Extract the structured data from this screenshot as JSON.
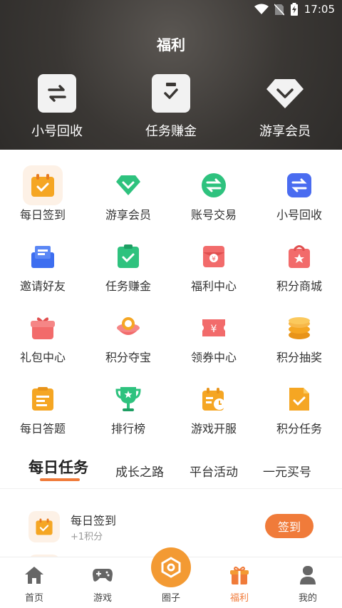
{
  "status_bar": {
    "time": "17:05"
  },
  "header": {
    "title": "福利",
    "hero": [
      {
        "label": "小号回收",
        "icon": "swap-icon"
      },
      {
        "label": "任务赚金",
        "icon": "clipboard-check-icon"
      },
      {
        "label": "游享会员",
        "icon": "diamond-icon"
      }
    ]
  },
  "grid": [
    {
      "label": "每日签到",
      "icon": "calendar-check-icon"
    },
    {
      "label": "游享会员",
      "icon": "diamond-icon"
    },
    {
      "label": "账号交易",
      "icon": "exchange-icon"
    },
    {
      "label": "小号回收",
      "icon": "swap-icon"
    },
    {
      "label": "邀请好友",
      "icon": "envelope-icon"
    },
    {
      "label": "任务赚金",
      "icon": "clipboard-check-icon"
    },
    {
      "label": "福利中心",
      "icon": "red-envelope-icon"
    },
    {
      "label": "积分商城",
      "icon": "shop-bag-icon"
    },
    {
      "label": "礼包中心",
      "icon": "gift-icon"
    },
    {
      "label": "积分夺宝",
      "icon": "treasure-icon"
    },
    {
      "label": "领券中心",
      "icon": "coupon-icon"
    },
    {
      "label": "积分抽奖",
      "icon": "coin-stack-icon"
    },
    {
      "label": "每日答题",
      "icon": "quiz-icon"
    },
    {
      "label": "排行榜",
      "icon": "trophy-icon"
    },
    {
      "label": "游戏开服",
      "icon": "calendar-clock-icon"
    },
    {
      "label": "积分任务",
      "icon": "task-doc-icon"
    }
  ],
  "tabs": [
    {
      "label": "每日任务",
      "active": true
    },
    {
      "label": "成长之路"
    },
    {
      "label": "平台活动"
    },
    {
      "label": "一元买号"
    }
  ],
  "tasks": [
    {
      "title": "每日签到",
      "reward": "+1积分",
      "button": "签到"
    }
  ],
  "bottom_nav": [
    {
      "label": "首页",
      "icon": "home-icon"
    },
    {
      "label": "游戏",
      "icon": "gamepad-icon"
    },
    {
      "label": "圈子",
      "icon": "hexagon-icon"
    },
    {
      "label": "福利",
      "icon": "gift-icon",
      "active": true
    },
    {
      "label": "我的",
      "icon": "user-icon"
    }
  ],
  "colors": {
    "accent": "#f07b3a",
    "header_bg": "#3a3734"
  }
}
